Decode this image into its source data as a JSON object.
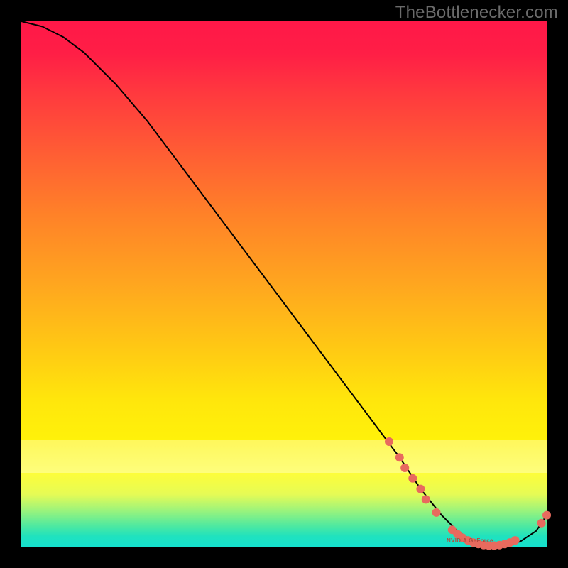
{
  "watermark": "TheBottlenecker.com",
  "gpu_label": "NVIDIA GeForce",
  "colors": {
    "top": "#ff1848",
    "mid": "#ffe60c",
    "bottom": "#15e0ce",
    "line": "#000000",
    "marker": "#e86a5e"
  },
  "chart_data": {
    "type": "line",
    "title": "",
    "xlabel": "",
    "ylabel": "",
    "xlim": [
      0,
      100
    ],
    "ylim": [
      0,
      100
    ],
    "curve_x": [
      0,
      4,
      8,
      12,
      18,
      24,
      30,
      36,
      42,
      48,
      54,
      60,
      66,
      72,
      76,
      80,
      83,
      86,
      89,
      92,
      95,
      98,
      100
    ],
    "curve_y": [
      100,
      99,
      97,
      94,
      88,
      81,
      73,
      65,
      57,
      49,
      41,
      33,
      25,
      17,
      11,
      6,
      3,
      1,
      0,
      0,
      1,
      3,
      6
    ],
    "markers": [
      {
        "x": 70,
        "y": 20
      },
      {
        "x": 72,
        "y": 17
      },
      {
        "x": 73,
        "y": 15
      },
      {
        "x": 74.5,
        "y": 13
      },
      {
        "x": 76,
        "y": 11
      },
      {
        "x": 77,
        "y": 9
      },
      {
        "x": 79,
        "y": 6.5
      },
      {
        "x": 82,
        "y": 3.2
      },
      {
        "x": 83,
        "y": 2.4
      },
      {
        "x": 84,
        "y": 1.7
      },
      {
        "x": 85,
        "y": 1.2
      },
      {
        "x": 86,
        "y": 0.8
      },
      {
        "x": 87,
        "y": 0.5
      },
      {
        "x": 88,
        "y": 0.3
      },
      {
        "x": 89,
        "y": 0.2
      },
      {
        "x": 90,
        "y": 0.2
      },
      {
        "x": 91,
        "y": 0.3
      },
      {
        "x": 92,
        "y": 0.5
      },
      {
        "x": 93,
        "y": 0.8
      },
      {
        "x": 94,
        "y": 1.2
      },
      {
        "x": 99,
        "y": 4.5
      },
      {
        "x": 100,
        "y": 6
      }
    ],
    "label_marker": {
      "x": 85,
      "y": 1.2
    }
  }
}
